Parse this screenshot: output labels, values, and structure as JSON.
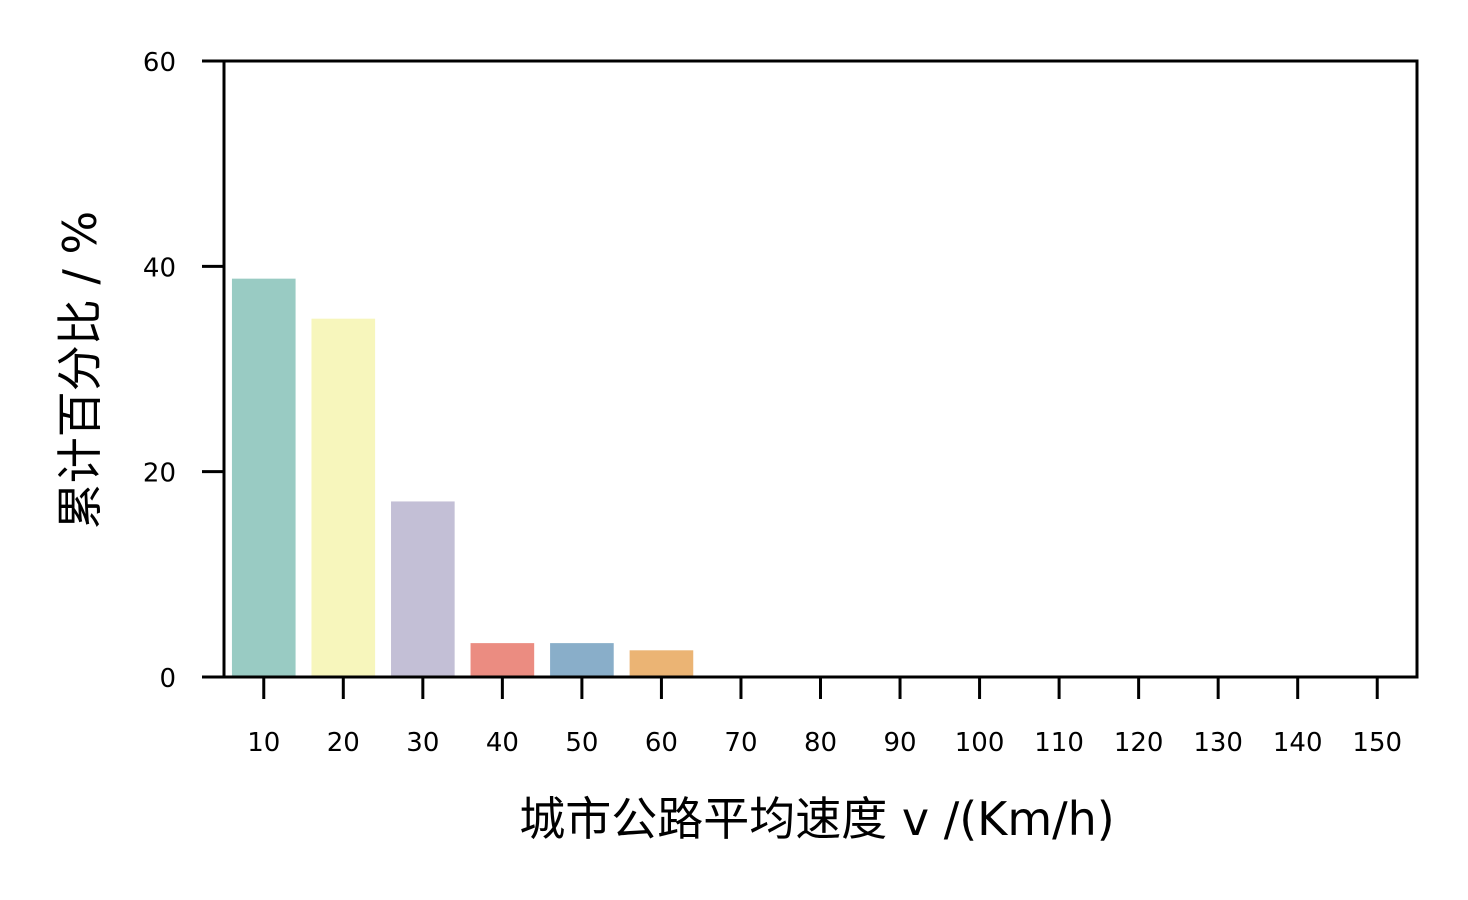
{
  "chart_data": {
    "type": "bar",
    "title": "",
    "xlabel": "城市公路平均速度 v /(Km/h)",
    "ylabel": "累计百分比 / %",
    "categories": [
      "10",
      "20",
      "30",
      "40",
      "50",
      "60",
      "70",
      "80",
      "90",
      "100",
      "110",
      "120",
      "130",
      "140",
      "150"
    ],
    "values": [
      38.8,
      34.9,
      17.1,
      3.3,
      3.3,
      2.6,
      0,
      0,
      0,
      0,
      0,
      0,
      0,
      0,
      0
    ],
    "colors": [
      "#99cbc3",
      "#f7f6bc",
      "#c3bfd6",
      "#eb8c81",
      "#89aec9",
      "#ebb474",
      "#b3d66b",
      "#f7cee1",
      "#d9d9d9",
      "#bc80bd",
      "#ccebc5",
      "#ffed6f",
      "#8dd3c7",
      "#ffffb3",
      "#bebada"
    ],
    "ylim": [
      0,
      60
    ],
    "yticks": [
      0,
      20,
      40,
      60
    ],
    "grid": false,
    "legend": "none"
  }
}
